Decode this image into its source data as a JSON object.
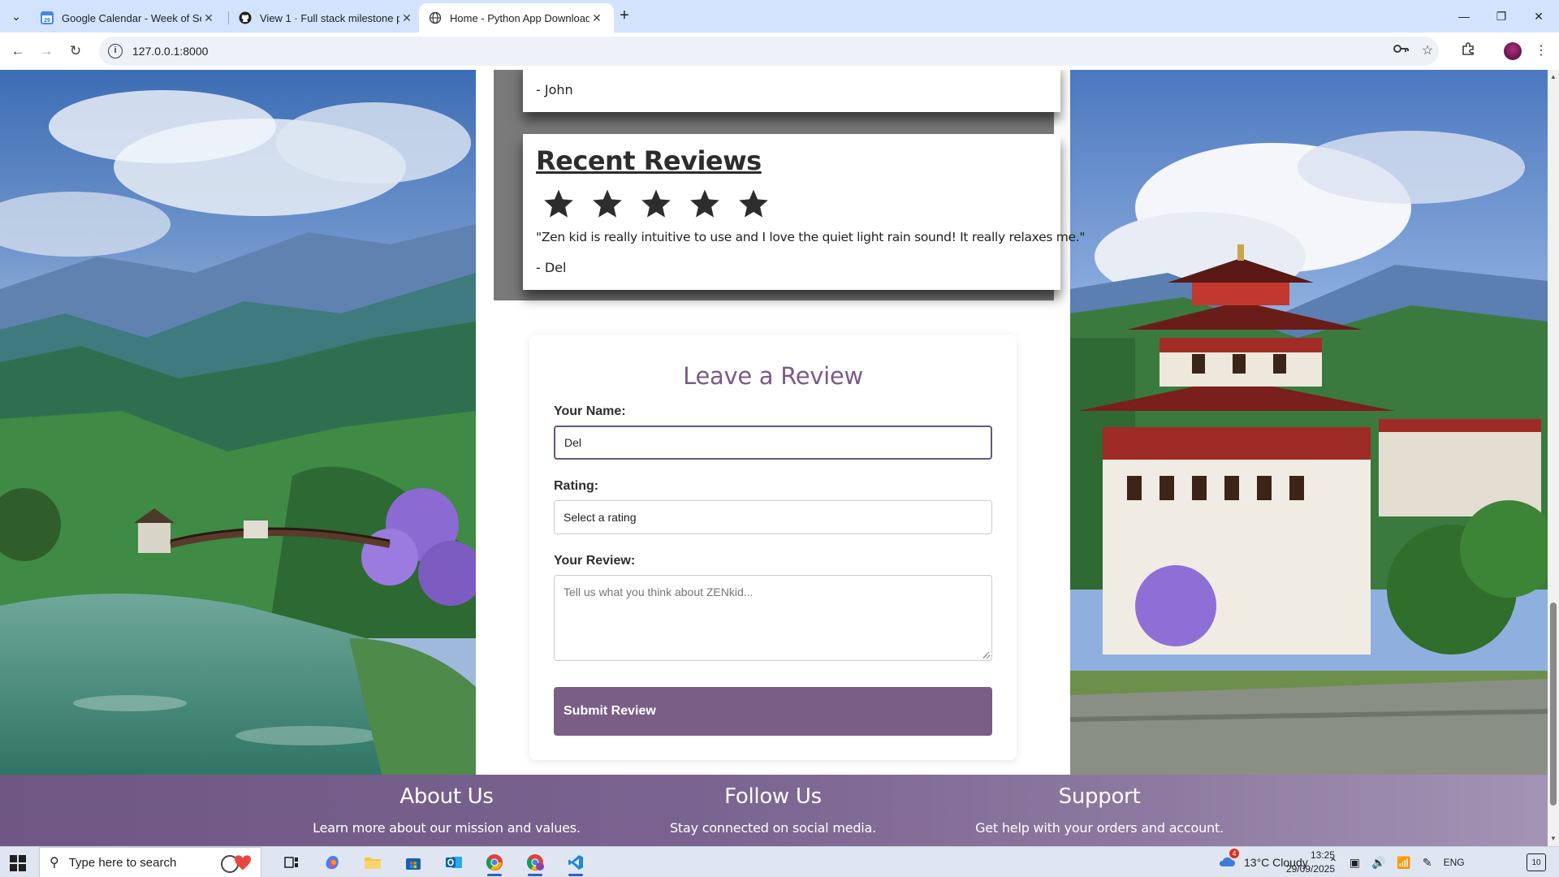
{
  "browser": {
    "tabs": [
      {
        "title": "Google Calendar - Week of Sep",
        "icon": "google-calendar-icon"
      },
      {
        "title": "View 1 · Full stack milestone pr",
        "icon": "github-icon"
      },
      {
        "title": "Home - Python App Download",
        "icon": "globe-icon",
        "active": true
      }
    ],
    "url": "127.0.0.1:8000"
  },
  "testimonials": {
    "previous_author": "- John",
    "recent_title": "Recent Reviews",
    "stars": 5,
    "quote": "\"Zen kid is really intuitive to use and I love the quiet light rain sound! It really relaxes me.\"",
    "author": "- Del"
  },
  "review_form": {
    "title": "Leave a Review",
    "name_label": "Your Name:",
    "name_value": "Del",
    "rating_label": "Rating:",
    "rating_value": "Select a rating",
    "review_label": "Your Review:",
    "review_placeholder": "Tell us what you think about ZENkid...",
    "submit_label": "Submit Review"
  },
  "footer": {
    "columns": [
      {
        "title": "About Us",
        "text": "Learn more about our mission and values."
      },
      {
        "title": "Follow Us",
        "text": "Stay connected on social media."
      },
      {
        "title": "Support",
        "text": "Get help with your orders and account."
      }
    ]
  },
  "taskbar": {
    "search_placeholder": "Type here to search",
    "weather": "13°C  Cloudy",
    "weather_badge": "4",
    "language": "ENG",
    "time": "13:25",
    "date": "29/09/2025",
    "notification_count": "10"
  },
  "colors": {
    "accent_purple": "#7a5e86",
    "tab_strip": "#d3e3fd",
    "star": "#2d2d2d"
  }
}
